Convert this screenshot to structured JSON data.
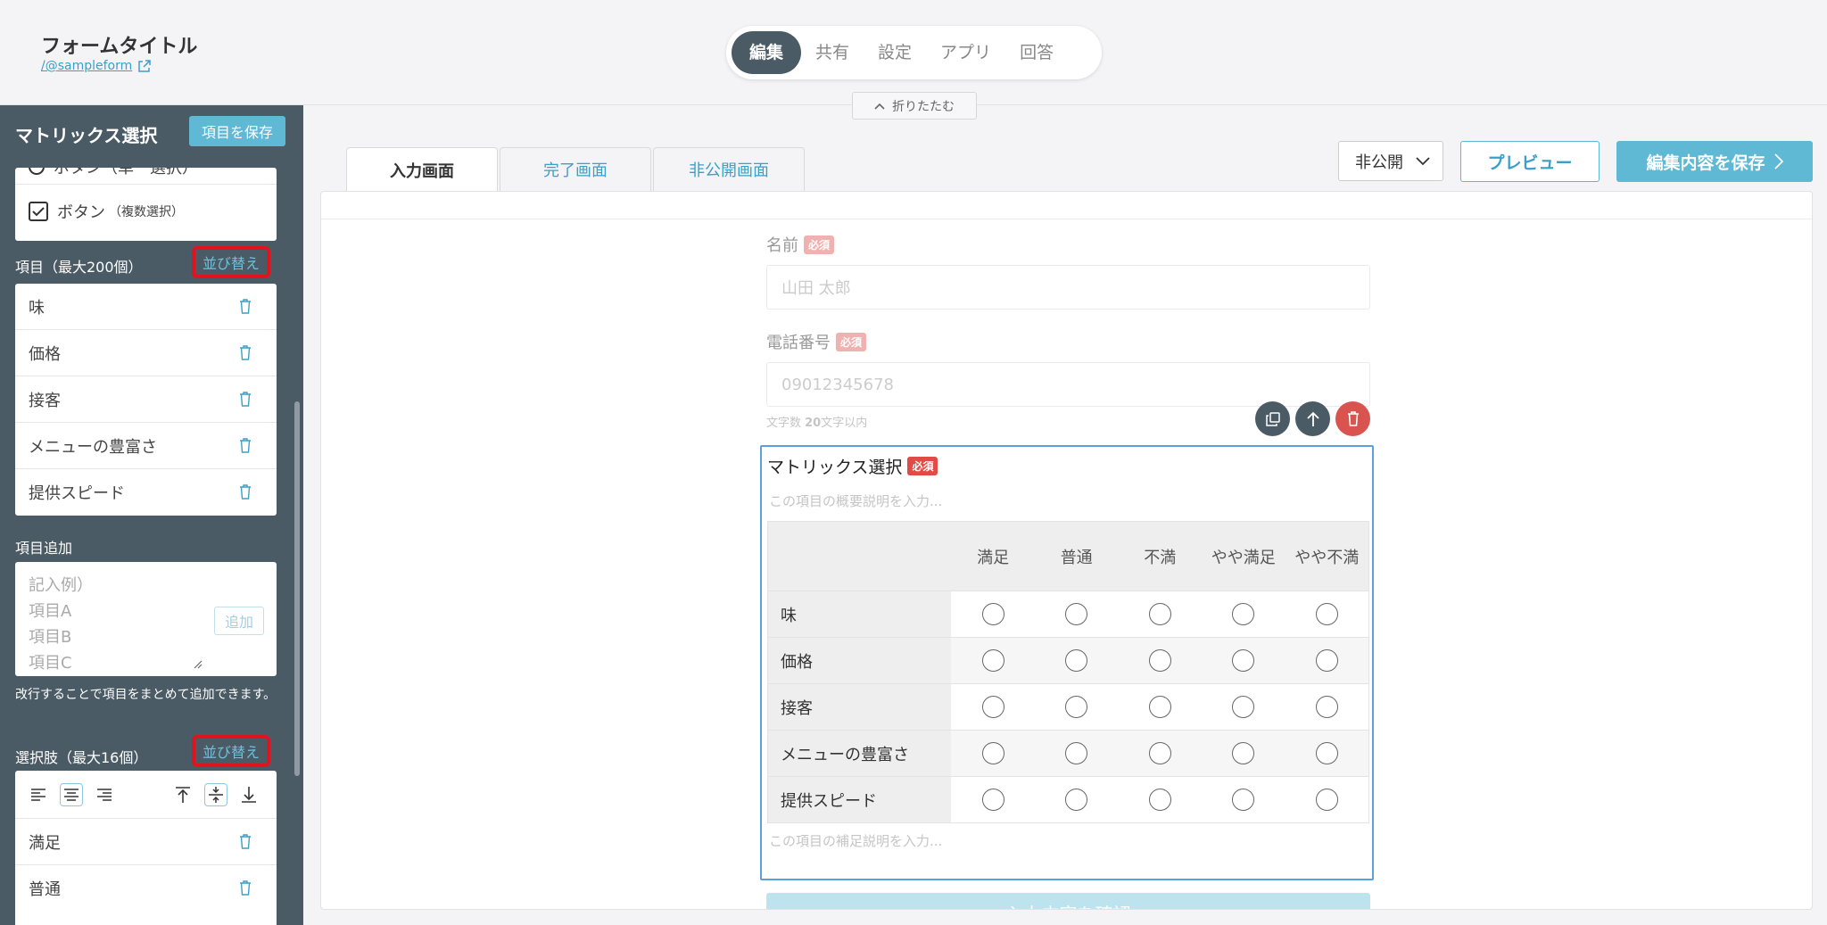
{
  "header": {
    "form_title": "フォームタイトル",
    "form_link": "/@sampleform",
    "nav_tabs": [
      "編集",
      "共有",
      "設定",
      "アプリ",
      "回答"
    ],
    "collapse_label": "折りたたむ"
  },
  "sidebar": {
    "title": "マトリックス選択",
    "save_label": "項目を保存",
    "type_partial": "ボタン（単一選択）",
    "type_multi_main": "ボタン",
    "type_multi_sub": "（複数選択）",
    "items_label": "項目（最大200個）",
    "reorder_label": "並び替え",
    "items": [
      "味",
      "価格",
      "接客",
      "メニューの豊富さ",
      "提供スピード"
    ],
    "add_label": "項目追加",
    "add_placeholder": "記入例）\n項目A\n項目B\n項目C",
    "add_button": "追加",
    "add_hint": "改行することで項目をまとめて追加できます。",
    "choices_label": "選択肢（最大16個）",
    "choices": [
      "満足",
      "普通"
    ]
  },
  "main": {
    "tabs": [
      "入力画面",
      "完了画面",
      "非公開画面"
    ],
    "visibility": "非公開",
    "preview_label": "プレビュー",
    "save_label": "編集内容を保存",
    "fields": {
      "name_label": "名前",
      "name_placeholder": "山田 太郎",
      "phone_label": "電話番号",
      "phone_placeholder": "09012345678",
      "required": "必須",
      "charcount_prefix": "文字数 ",
      "charcount_num": "20",
      "charcount_suffix": "文字以内"
    },
    "matrix": {
      "title": "マトリックス選択",
      "required": "必須",
      "desc_placeholder": "この項目の概要説明を入力...",
      "columns": [
        "満足",
        "普通",
        "不満",
        "やや満足",
        "やや不満"
      ],
      "rows": [
        "味",
        "価格",
        "接客",
        "メニューの豊富さ",
        "提供スピード"
      ],
      "foot_placeholder": "この項目の補足説明を入力..."
    },
    "submit_label": "入力内容を確認"
  }
}
